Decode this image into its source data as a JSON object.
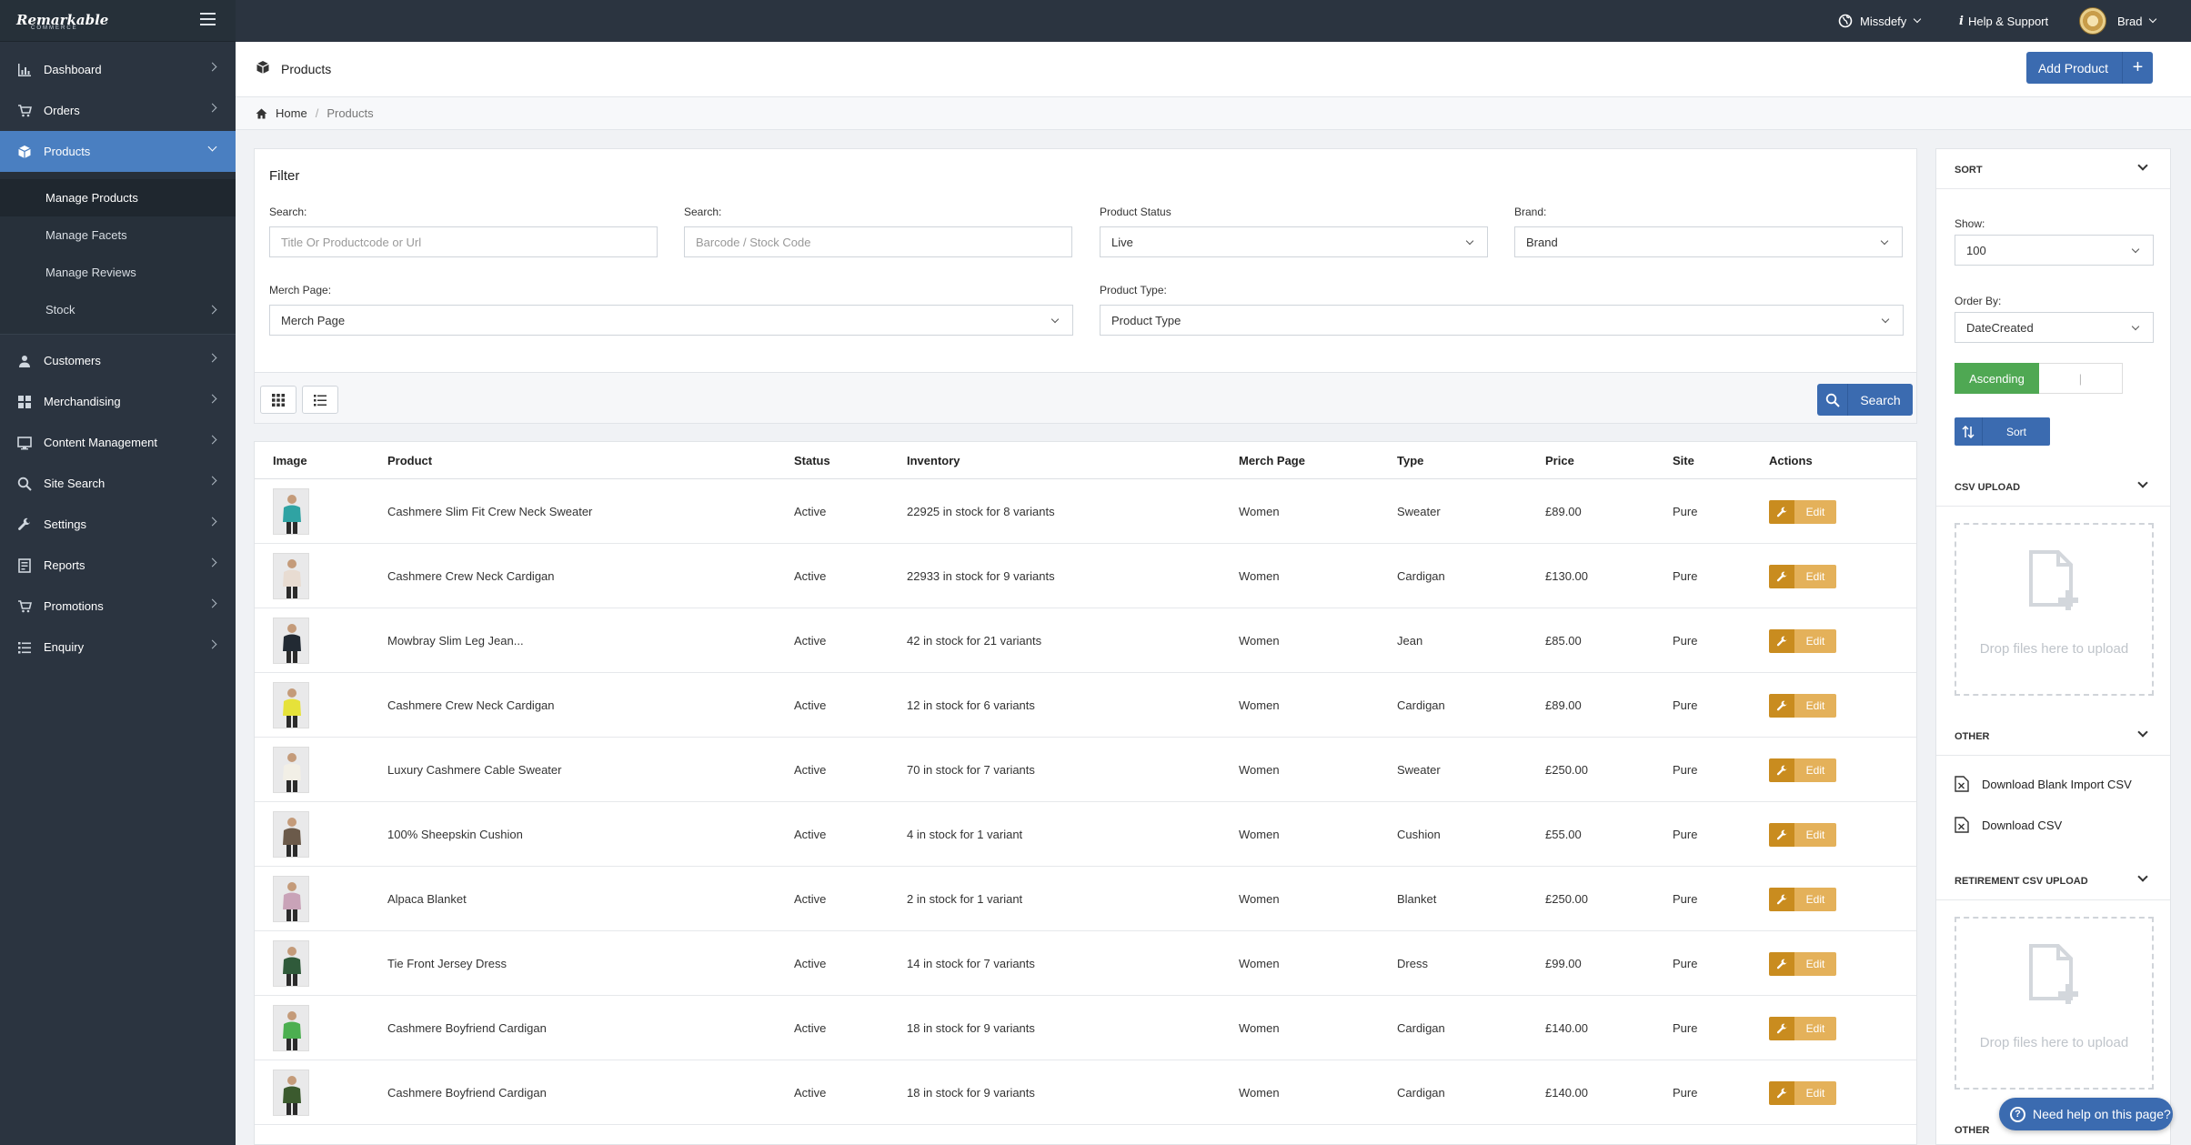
{
  "app": {
    "logo_text": "Remarkable",
    "logo_sub": "COMMERCE"
  },
  "topbar": {
    "site": "Missdefy",
    "help": "Help & Support",
    "user": "Brad"
  },
  "sidebar": {
    "items": [
      {
        "label": "Dashboard",
        "icon": "bar-chart-icon"
      },
      {
        "label": "Orders",
        "icon": "cart-icon"
      },
      {
        "label": "Products",
        "icon": "box-icon",
        "active": true
      },
      {
        "label": "Customers",
        "icon": "user-icon"
      },
      {
        "label": "Merchandising",
        "icon": "grid-icon"
      },
      {
        "label": "Content Management",
        "icon": "monitor-icon"
      },
      {
        "label": "Site Search",
        "icon": "search-icon"
      },
      {
        "label": "Settings",
        "icon": "wrench-icon"
      },
      {
        "label": "Reports",
        "icon": "report-icon"
      },
      {
        "label": "Promotions",
        "icon": "cart-icon"
      },
      {
        "label": "Enquiry",
        "icon": "list-icon"
      }
    ],
    "sub_items": [
      {
        "label": "Manage Products",
        "active": true
      },
      {
        "label": "Manage Facets"
      },
      {
        "label": "Manage Reviews"
      },
      {
        "label": "Stock"
      }
    ]
  },
  "page": {
    "title": "Products",
    "add_button": "Add Product"
  },
  "breadcrumb": {
    "home": "Home",
    "current": "Products"
  },
  "filter": {
    "title": "Filter",
    "search1_label": "Search:",
    "search1_placeholder": "Title Or Productcode or Url",
    "search2_label": "Search:",
    "search2_placeholder": "Barcode / Stock Code",
    "status_label": "Product Status",
    "status_value": "Live",
    "brand_label": "Brand:",
    "brand_value": "Brand",
    "merch_label": "Merch Page:",
    "merch_value": "Merch Page",
    "type_label": "Product Type:",
    "type_value": "Product Type",
    "search_button": "Search"
  },
  "table": {
    "headers": [
      "Image",
      "Product",
      "Status",
      "Inventory",
      "Merch Page",
      "Type",
      "Price",
      "Site",
      "Actions"
    ],
    "edit_label": "Edit",
    "rows": [
      {
        "product": "Cashmere Slim Fit Crew Neck Sweater",
        "status": "Active",
        "inventory": "22925 in stock for 8 variants",
        "merch": "Women",
        "type": "Sweater",
        "price": "£89.00",
        "site": "Pure",
        "color": "#2fa3a3"
      },
      {
        "product": "Cashmere Crew Neck Cardigan",
        "status": "Active",
        "inventory": "22933 in stock for 9 variants",
        "merch": "Women",
        "type": "Cardigan",
        "price": "£130.00",
        "site": "Pure",
        "color": "#e8dcd2"
      },
      {
        "product": "Mowbray Slim Leg Jean...",
        "status": "Active",
        "inventory": "42 in stock for 21 variants",
        "merch": "Women",
        "type": "Jean",
        "price": "£85.00",
        "site": "Pure",
        "color": "#222a33"
      },
      {
        "product": "Cashmere Crew Neck Cardigan",
        "status": "Active",
        "inventory": "12 in stock for 6 variants",
        "merch": "Women",
        "type": "Cardigan",
        "price": "£89.00",
        "site": "Pure",
        "color": "#e6e23a"
      },
      {
        "product": "Luxury Cashmere Cable Sweater",
        "status": "Active",
        "inventory": "70 in stock for 7 variants",
        "merch": "Women",
        "type": "Sweater",
        "price": "£250.00",
        "site": "Pure",
        "color": "#f2efe6"
      },
      {
        "product": "100% Sheepskin Cushion",
        "status": "Active",
        "inventory": "4 in stock for 1 variant",
        "merch": "Women",
        "type": "Cushion",
        "price": "£55.00",
        "site": "Pure",
        "color": "#6b5a4a"
      },
      {
        "product": "Alpaca Blanket",
        "status": "Active",
        "inventory": "2 in stock for 1 variant",
        "merch": "Women",
        "type": "Blanket",
        "price": "£250.00",
        "site": "Pure",
        "color": "#c9a3b8"
      },
      {
        "product": "Tie Front Jersey Dress",
        "status": "Active",
        "inventory": "14 in stock for 7 variants",
        "merch": "Women",
        "type": "Dress",
        "price": "£99.00",
        "site": "Pure",
        "color": "#2f5a3a"
      },
      {
        "product": "Cashmere Boyfriend Cardigan",
        "status": "Active",
        "inventory": "18 in stock for 9 variants",
        "merch": "Women",
        "type": "Cardigan",
        "price": "£140.00",
        "site": "Pure",
        "color": "#4caf50"
      },
      {
        "product": "Cashmere Boyfriend Cardigan",
        "status": "Active",
        "inventory": "18 in stock for 9 variants",
        "merch": "Women",
        "type": "Cardigan",
        "price": "£140.00",
        "site": "Pure",
        "color": "#3b5a2e"
      }
    ]
  },
  "right_panel": {
    "sort_title": "SORT",
    "show_label": "Show:",
    "show_value": "100",
    "order_label": "Order By:",
    "order_value": "DateCreated",
    "ascending": "Ascending",
    "sort_button": "Sort",
    "csv_title": "CSV UPLOAD",
    "drop_text": "Drop files here to upload",
    "other_title": "OTHER",
    "download_blank": "Download Blank Import CSV",
    "download_csv": "Download CSV",
    "retire_title": "RETIREMENT CSV UPLOAD",
    "drop_text2": "Drop files here to upload",
    "other_title2": "OTHER"
  },
  "help_float": "Need help on this page?",
  "colors": {
    "sidebar": "#2b3440",
    "accent": "#3b6bb0",
    "active_nav": "#4a7fc1",
    "edit": "#e4b15a",
    "ascending": "#4fa853"
  }
}
